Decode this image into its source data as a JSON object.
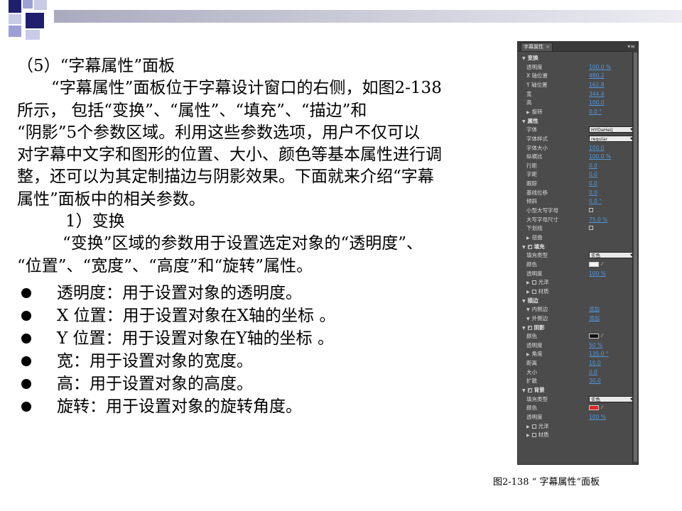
{
  "colors": {
    "navy": "#1f1f6e",
    "periwinkle": "#9da0d4",
    "link_blue": "#4f98e0",
    "shadow_swatch": "#111111",
    "bg_swatch": "#e02424",
    "fill_swatch": "#f2f2f2"
  },
  "paragraphs": [
    "（5）“字幕属性”面板",
    "“字幕属性”面板位于字幕设计窗口的右侧，如图2-138",
    "所示， 包括“变换”、“属性”、“填充”、“描边”和",
    "“阴影”5个参数区域。利用这些参数选项，用户不仅可以",
    "对字幕中文字和图形的位置、大小、颜色等基本属性进行调",
    "整，还可以为其定制描边与阴影效果。下面就来介绍“字幕",
    "属性”面板中的相关参数。",
    "1）变换",
    "“变换”区域的参数用于设置选定对象的“透明度”、",
    "“位置”、“宽度”、“高度”和“旋转”属性。"
  ],
  "bullets": [
    "透明度：用于设置对象的透明度。",
    "X 位置：用于设置对象在X轴的坐标 。",
    "Y 位置：用于设置对象在Y轴的坐标 。",
    "宽：用于设置对象的宽度。",
    "高：用于设置对象的高度。",
    "旋转：用于设置对象的旋转角度。"
  ],
  "panel": {
    "tab": "字幕属性",
    "tab_close": "×",
    "menu": "▾≡",
    "rows": [
      {
        "kind": "sec",
        "arrow": "▼",
        "label": "变换"
      },
      {
        "kind": "field",
        "label": "透明度",
        "value": "100.0 %"
      },
      {
        "kind": "field",
        "label": "X 轴位置",
        "value": "480.2"
      },
      {
        "kind": "field",
        "label": "Y 轴位置",
        "value": "162.8"
      },
      {
        "kind": "field",
        "label": "宽",
        "value": "344.4"
      },
      {
        "kind": "field",
        "label": "高",
        "value": "100.0"
      },
      {
        "kind": "sub",
        "arrow": "▶",
        "label": "旋转",
        "value": "0.0 °"
      },
      {
        "kind": "sec",
        "arrow": "▼",
        "label": "属性"
      },
      {
        "kind": "select",
        "label": "字体",
        "value": "HYDaHeiJ"
      },
      {
        "kind": "select",
        "label": "字体样式",
        "value": "regular"
      },
      {
        "kind": "field",
        "label": "字体大小",
        "value": "100.0"
      },
      {
        "kind": "field",
        "label": "纵横比",
        "value": "100.0 %"
      },
      {
        "kind": "field",
        "label": "行距",
        "value": "0.0"
      },
      {
        "kind": "field",
        "label": "字距",
        "value": "0.0"
      },
      {
        "kind": "field",
        "label": "跟踪",
        "value": "0.0"
      },
      {
        "kind": "field",
        "label": "基线位移",
        "value": "0.0"
      },
      {
        "kind": "field",
        "label": "倾斜",
        "value": "0.0 °"
      },
      {
        "kind": "check",
        "label": "小型大写字母"
      },
      {
        "kind": "field",
        "label": "大写字母尺寸",
        "value": "75.0 %"
      },
      {
        "kind": "check",
        "label": "下划线"
      },
      {
        "kind": "sub",
        "arrow": "▶",
        "label": "扭曲"
      },
      {
        "kind": "seccheck",
        "arrow": "▼",
        "label": "填充"
      },
      {
        "kind": "select",
        "label": "填充类型",
        "value": "实色"
      },
      {
        "kind": "color",
        "label": "颜色",
        "swatch": "fill_swatch"
      },
      {
        "kind": "field",
        "label": "透明度",
        "value": "100 %"
      },
      {
        "kind": "subcheck",
        "arrow": "▶",
        "label": "光泽"
      },
      {
        "kind": "subcheck",
        "arrow": "▶",
        "label": "材质"
      },
      {
        "kind": "sec",
        "arrow": "▼",
        "label": "描边"
      },
      {
        "kind": "sub",
        "arrow": "▼",
        "label": "内侧边",
        "value": "添加"
      },
      {
        "kind": "sub",
        "arrow": "▼",
        "label": "外侧边",
        "value": "添加"
      },
      {
        "kind": "seccheck",
        "arrow": "▼",
        "label": "阴影"
      },
      {
        "kind": "color",
        "label": "颜色",
        "swatch": "shadow_swatch"
      },
      {
        "kind": "field",
        "label": "透明度",
        "value": "50 %"
      },
      {
        "kind": "sub",
        "arrow": "▶",
        "label": "角度",
        "value": "135.0 °"
      },
      {
        "kind": "field",
        "label": "距离",
        "value": "10.0"
      },
      {
        "kind": "field",
        "label": "大小",
        "value": "0.0"
      },
      {
        "kind": "field",
        "label": "扩散",
        "value": "30.0"
      },
      {
        "kind": "seccheck",
        "arrow": "▼",
        "label": "背景"
      },
      {
        "kind": "select",
        "label": "填充类型",
        "value": "实色"
      },
      {
        "kind": "color",
        "label": "颜色",
        "swatch": "bg_swatch"
      },
      {
        "kind": "field",
        "label": "透明度",
        "value": "100 %"
      },
      {
        "kind": "subcheck",
        "arrow": "▶",
        "label": "光泽"
      },
      {
        "kind": "subcheck",
        "arrow": "▶",
        "label": "材质"
      }
    ]
  },
  "caption": "图2-138 “ 字幕属性”面板"
}
